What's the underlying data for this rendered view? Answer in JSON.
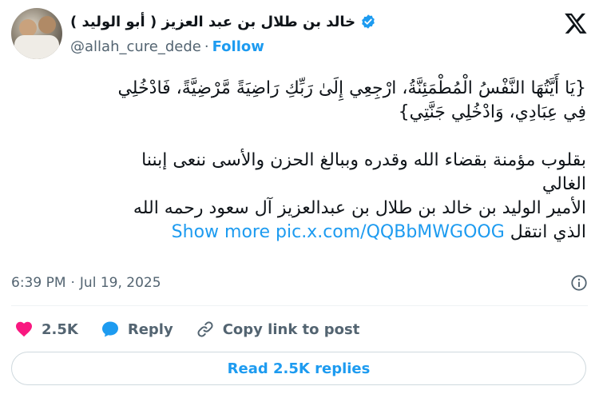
{
  "author": {
    "display_name": "خالد بن طلال بن عبد العزيز ( أبو الوليد )",
    "handle": "@allah_cure_dede",
    "separator": "·",
    "follow_label": "Follow",
    "verified": true
  },
  "tweet": {
    "line1": "{يَا أَيَّتُهَا النَّفْسُ الْمُطْمَئِنَّةُ، ارْجِعِي إِلَىٰ رَبِّكِ رَاضِيَةً مَّرْضِيَّةً، فَادْخُلِي",
    "line2": "فِي عِبَادِي، وَادْخُلِي جَنَّتِي}",
    "line3": "بقلوب مؤمنة بقضاء الله وقدره وببالغ الحزن والأسى ننعى إبننا",
    "line4": "الغالي",
    "line5": "الأمير الوليد بن خالد بن طلال بن عبدالعزيز آل سعود رحمه الله",
    "line6_text": "الذي انتقل",
    "show_more": "Show more",
    "media_link": "pic.x.com/QQBbMWGOOG"
  },
  "meta": {
    "time": "6:39 PM",
    "separator": "·",
    "date": "Jul 19, 2025"
  },
  "actions": {
    "likes": "2.5K",
    "reply_label": "Reply",
    "copy_label": "Copy link to post"
  },
  "read_replies": "Read 2.5K replies",
  "colors": {
    "accent": "#1d9bf0",
    "like": "#f91880",
    "muted": "#536471",
    "text": "#0f1419"
  },
  "icons": [
    "verified-badge-icon",
    "x-logo-icon",
    "info-icon",
    "heart-icon",
    "reply-bubble-icon",
    "link-icon"
  ]
}
